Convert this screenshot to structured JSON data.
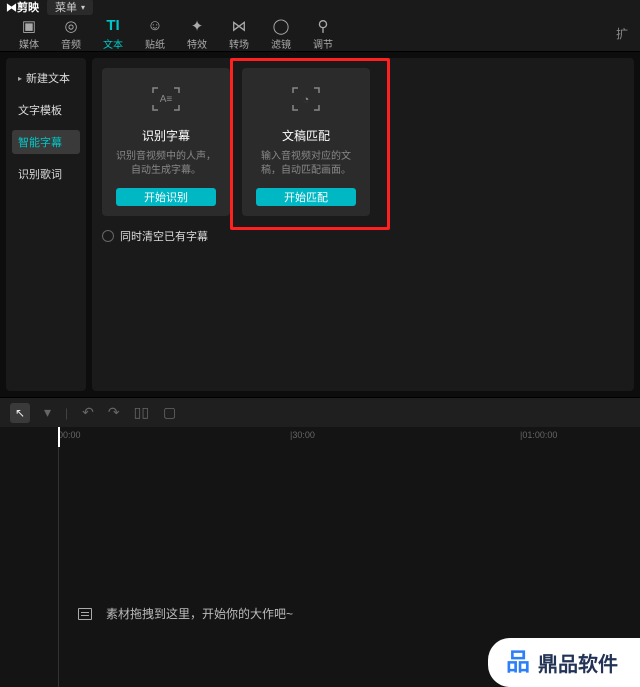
{
  "titlebar": {
    "logo": "剪映",
    "menu": "菜单"
  },
  "toolbar": {
    "items": [
      {
        "label": "媒体"
      },
      {
        "label": "音频"
      },
      {
        "label": "文本"
      },
      {
        "label": "贴纸"
      },
      {
        "label": "特效"
      },
      {
        "label": "转场"
      },
      {
        "label": "滤镜"
      },
      {
        "label": "调节"
      }
    ],
    "extra": "扩"
  },
  "sidebar": {
    "items": [
      {
        "label": "新建文本"
      },
      {
        "label": "文字模板"
      },
      {
        "label": "智能字幕"
      },
      {
        "label": "识别歌词"
      }
    ]
  },
  "cards": [
    {
      "title": "识别字幕",
      "desc": "识别音视频中的人声，自动生成字幕。",
      "btn": "开始识别"
    },
    {
      "title": "文稿匹配",
      "desc": "输入音视频对应的文稿，自动匹配画面。",
      "btn": "开始匹配"
    }
  ],
  "checkbox_label": "同时清空已有字幕",
  "ruler": {
    "t0": "00:00",
    "t1": "|30:00",
    "t2": "|01:00:00"
  },
  "drop_hint": "素材拖拽到这里，开始你的大作吧~",
  "watermark": "鼎品软件"
}
